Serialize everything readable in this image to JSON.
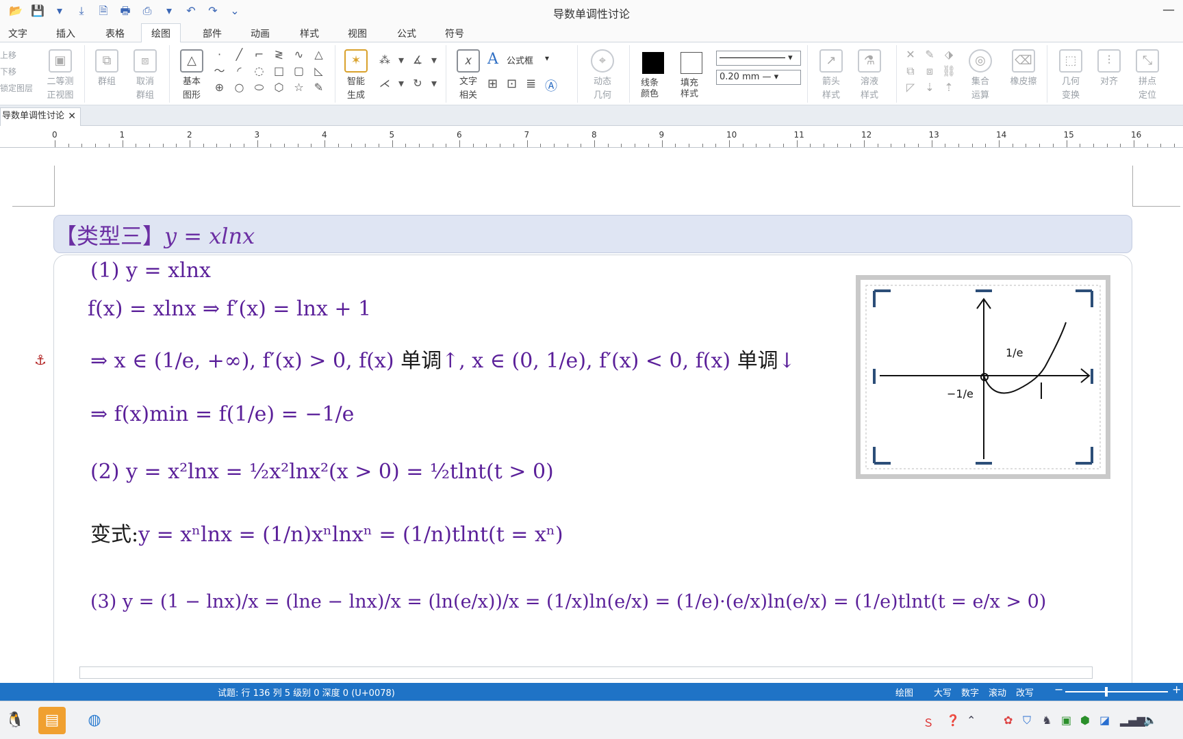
{
  "window": {
    "title": "导数单调性讨论",
    "minimize": "—"
  },
  "quick_access": [
    "📂",
    "💾",
    "▾",
    "⤓",
    "🗎",
    "🖶",
    "⎙",
    "▾",
    "↶",
    "↷",
    "⌄"
  ],
  "tabs": [
    "文字",
    "插入",
    "表格",
    "绘图",
    "部件",
    "动画",
    "样式",
    "视图",
    "公式",
    "符号"
  ],
  "ribbon": {
    "side_labels": [
      "上移",
      "下移",
      "锁定图层"
    ],
    "buttons": {
      "solid_front": "二等测\n正视图",
      "group": "群组",
      "ungroup": "取消\n群组",
      "basic_shapes": "基本\n图形",
      "smart_gen": "智能\n生成",
      "text_related": "文字\n相关",
      "formula_box": "公式框",
      "dynamic_geom": "动态\n几何",
      "line_color": "线条\n颜色",
      "fill_style": "填充\n样式",
      "arrow_style": "箭头\n样式",
      "solution_style": "溶液\n样式",
      "set_ops": "集合\n运算",
      "eraser": "橡皮擦",
      "geom_transform": "几何\n变换",
      "align": "对齐",
      "snap": "拼点\n定位"
    },
    "line_width": "0.20 mm"
  },
  "doc_tab": {
    "name": "导数单调性讨论",
    "close": "✕"
  },
  "ruler": [
    "0",
    "1",
    "2",
    "3",
    "4",
    "5",
    "6",
    "7",
    "8",
    "9",
    "10",
    "11",
    "12",
    "13",
    "14",
    "15",
    "16"
  ],
  "content": {
    "type_header": "【类型三】",
    "type_formula": "y = xlnx",
    "line1": "(1) y = xlnx",
    "line2": "f(x) = xlnx ⇒ f′(x) = lnx + 1",
    "line3a": "⇒ x ∈ (1/e, +∞), f′(x) > 0, f(x)",
    "line3b": "单调",
    "line3c": "↑, x ∈ (0, 1/e), f′(x) < 0, f(x)",
    "line3d": "单调",
    "line3e": "↓",
    "line4": "⇒ f(x)min = f(1/e) = −1/e",
    "line5": "(2) y = x²lnx = ½x²lnx²(x > 0) = ½tlnt(t > 0)",
    "line6_label": "变式:",
    "line6": "y = xⁿlnx = (1/n)xⁿlnxⁿ = (1/n)tlnt(t = xⁿ)",
    "line7": "(3) y = (1 − lnx)/x = (lne − lnx)/x = (ln(e/x))/x = (1/x)ln(e/x) = (1/e)·(e/x)ln(e/x) = (1/e)tlnt(t = e/x > 0)"
  },
  "status": {
    "left": "试题: 行 136   列 5   级别 0   深度 0  (U+0078)",
    "items": [
      "绘图",
      "大写",
      "数字",
      "滚动",
      "改写"
    ]
  }
}
